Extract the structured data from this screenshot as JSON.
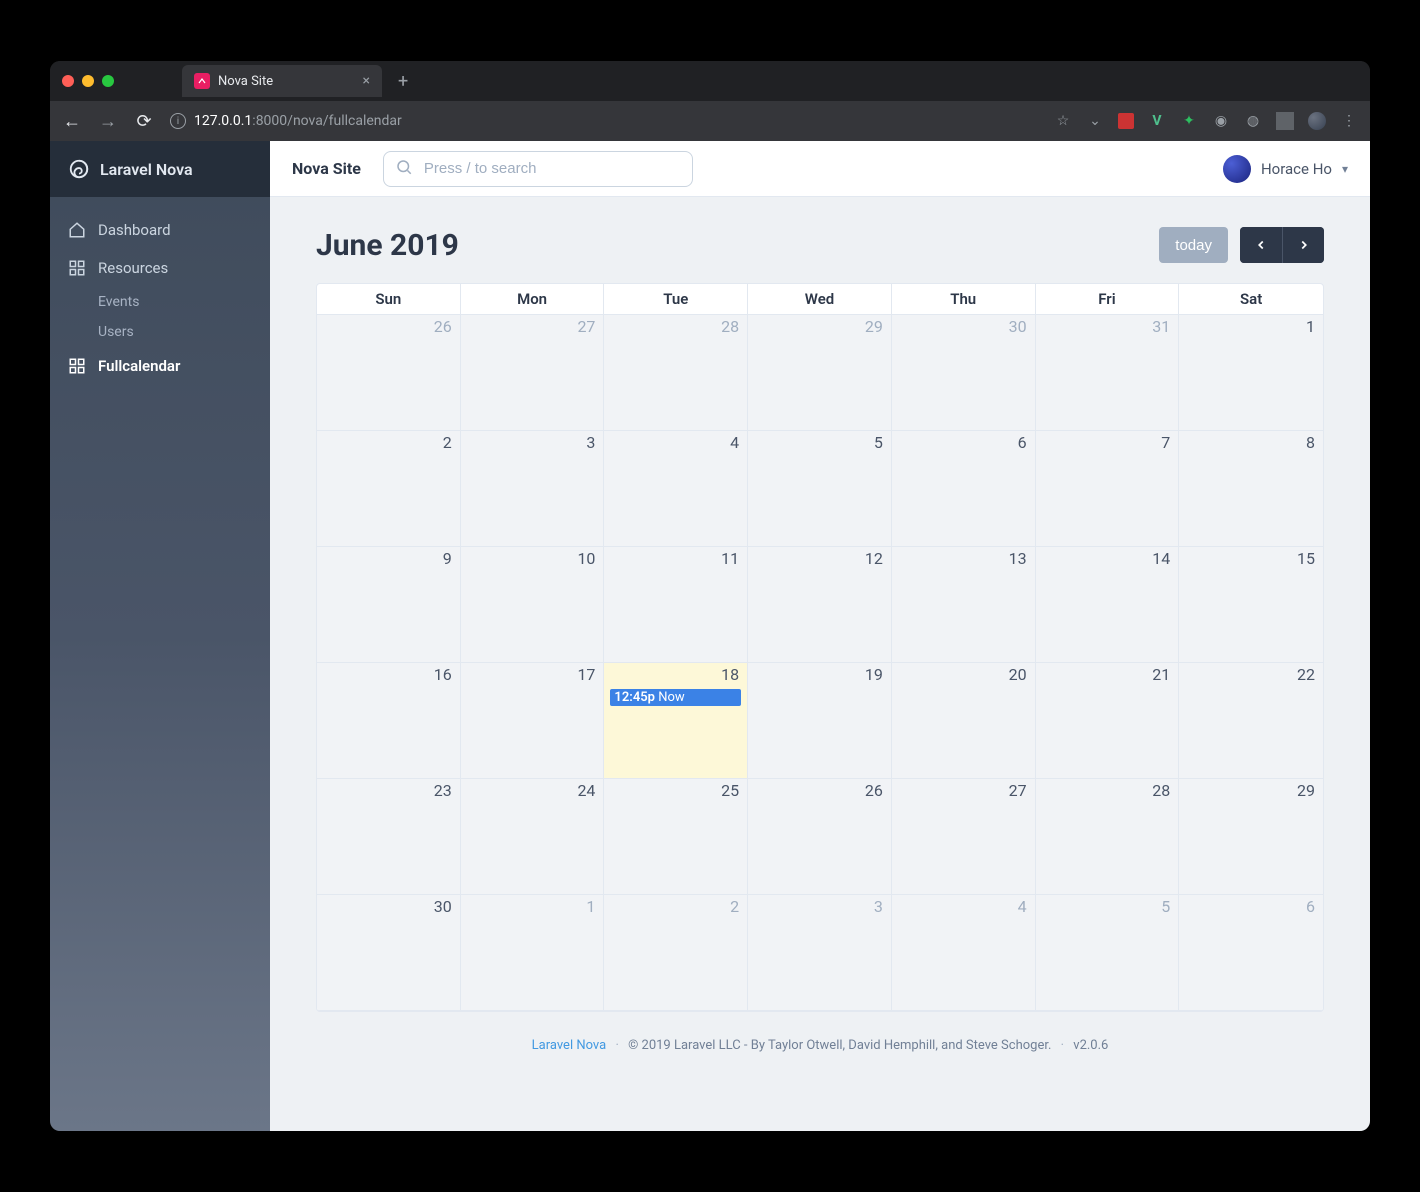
{
  "browser": {
    "tab_title": "Nova Site",
    "url_host": "127.0.0.1",
    "url_port": ":8000",
    "url_path": "/nova/fullcalendar"
  },
  "brand": "Laravel Nova",
  "sidebar": {
    "dashboard": "Dashboard",
    "resources": "Resources",
    "sub": {
      "events": "Events",
      "users": "Users"
    },
    "fullcalendar": "Fullcalendar"
  },
  "topbar": {
    "site_name": "Nova Site",
    "search_placeholder": "Press / to search",
    "user_name": "Horace Ho"
  },
  "calendar": {
    "title": "June 2019",
    "today_label": "today",
    "dow": [
      "Sun",
      "Mon",
      "Tue",
      "Wed",
      "Thu",
      "Fri",
      "Sat"
    ],
    "cells": [
      {
        "n": "26",
        "other": true
      },
      {
        "n": "27",
        "other": true
      },
      {
        "n": "28",
        "other": true
      },
      {
        "n": "29",
        "other": true
      },
      {
        "n": "30",
        "other": true
      },
      {
        "n": "31",
        "other": true
      },
      {
        "n": "1"
      },
      {
        "n": "2"
      },
      {
        "n": "3"
      },
      {
        "n": "4"
      },
      {
        "n": "5"
      },
      {
        "n": "6"
      },
      {
        "n": "7"
      },
      {
        "n": "8"
      },
      {
        "n": "9"
      },
      {
        "n": "10"
      },
      {
        "n": "11"
      },
      {
        "n": "12"
      },
      {
        "n": "13"
      },
      {
        "n": "14"
      },
      {
        "n": "15"
      },
      {
        "n": "16"
      },
      {
        "n": "17"
      },
      {
        "n": "18",
        "today": true,
        "event": {
          "time": "12:45p",
          "title": "Now"
        }
      },
      {
        "n": "19"
      },
      {
        "n": "20"
      },
      {
        "n": "21"
      },
      {
        "n": "22"
      },
      {
        "n": "23"
      },
      {
        "n": "24"
      },
      {
        "n": "25"
      },
      {
        "n": "26"
      },
      {
        "n": "27"
      },
      {
        "n": "28"
      },
      {
        "n": "29"
      },
      {
        "n": "30"
      },
      {
        "n": "1",
        "other": true
      },
      {
        "n": "2",
        "other": true
      },
      {
        "n": "3",
        "other": true
      },
      {
        "n": "4",
        "other": true
      },
      {
        "n": "5",
        "other": true
      },
      {
        "n": "6",
        "other": true
      }
    ]
  },
  "footer": {
    "link": "Laravel Nova",
    "copyright": "© 2019 Laravel LLC - By Taylor Otwell, David Hemphill, and Steve Schoger.",
    "version": "v2.0.6"
  }
}
